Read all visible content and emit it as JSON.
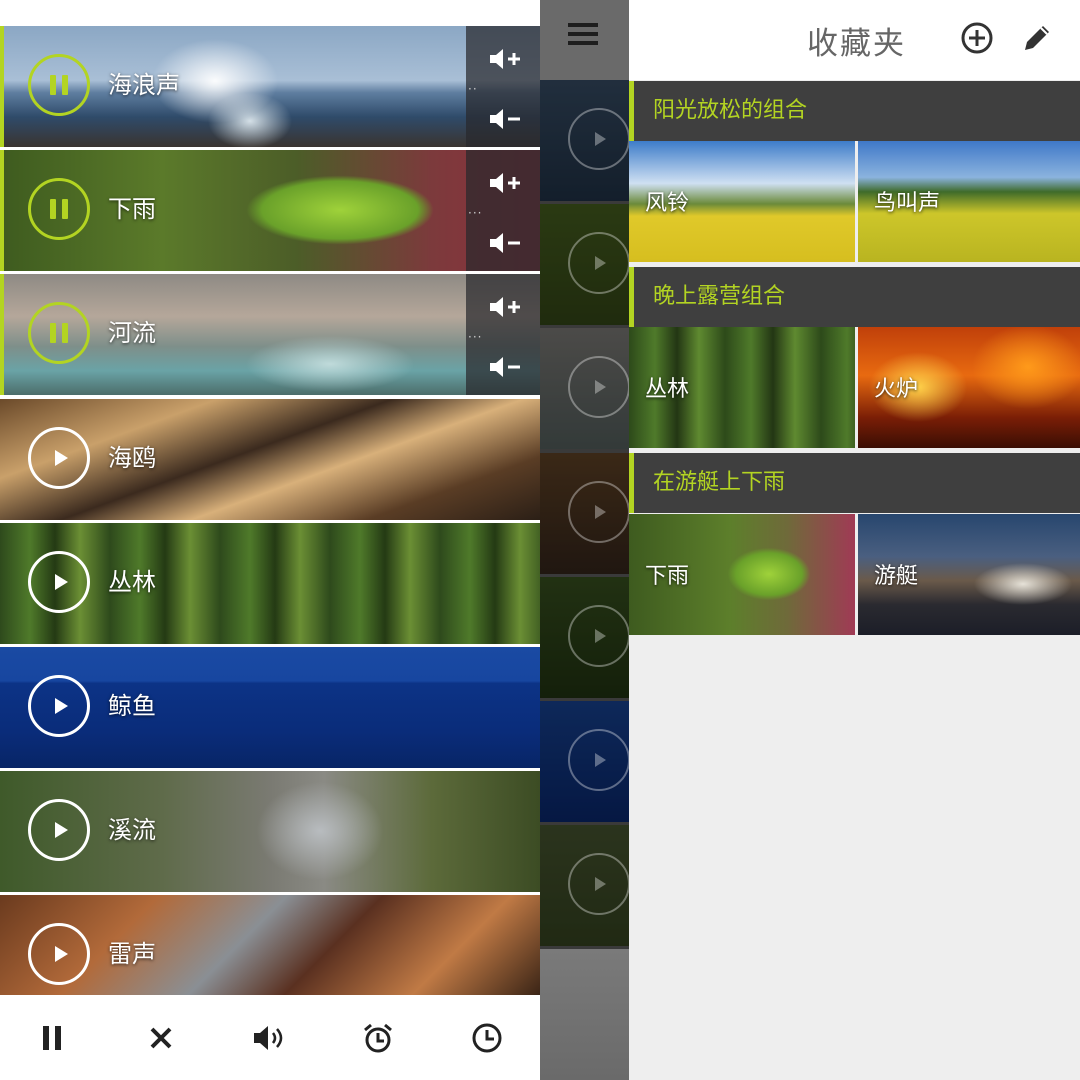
{
  "left_panel": {
    "sounds": [
      {
        "label": "海浪声",
        "state": "playing"
      },
      {
        "label": "下雨",
        "state": "playing"
      },
      {
        "label": "河流",
        "state": "playing"
      },
      {
        "label": "海鸥",
        "state": "stopped"
      },
      {
        "label": "丛林",
        "state": "stopped"
      },
      {
        "label": "鲸鱼",
        "state": "stopped"
      },
      {
        "label": "溪流",
        "state": "stopped"
      },
      {
        "label": "雷声",
        "state": "stopped"
      }
    ],
    "volume_icons": [
      "volume-up-icon",
      "volume-down-icon"
    ],
    "bottom_bar": [
      "pause-icon",
      "close-icon",
      "volume-icon",
      "alarm-clock-icon",
      "clock-icon"
    ]
  },
  "right_panel": {
    "title": "收藏夹",
    "header_icons": [
      "add-circle-icon",
      "edit-pencil-icon"
    ],
    "groups": [
      {
        "name": "阳光放松的组合",
        "items": [
          "风铃",
          "鸟叫声"
        ]
      },
      {
        "name": "晚上露营组合",
        "items": [
          "丛林",
          "火炉"
        ]
      },
      {
        "name": "在游艇上下雨",
        "items": [
          "下雨",
          "游艇"
        ]
      }
    ]
  },
  "colors": {
    "accent": "#b3d422",
    "group_header_bg": "#3f3f3f",
    "panel_bg": "#eeeeee"
  }
}
